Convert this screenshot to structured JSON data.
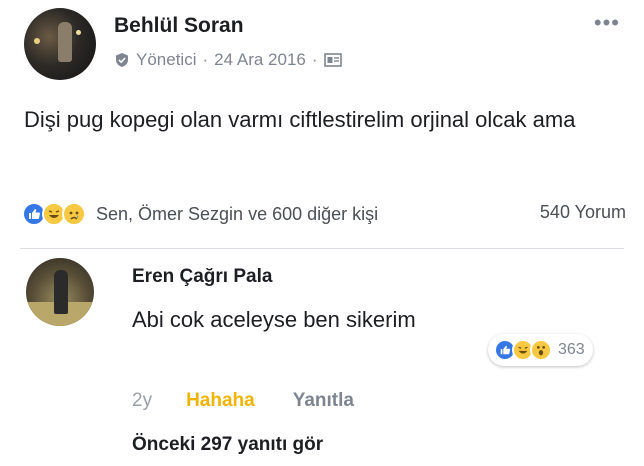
{
  "post": {
    "author": "Behlül Soran",
    "role": "Yönetici",
    "separator": "·",
    "date": "24 Ara 2016",
    "more_label": "•••",
    "text": "Dişi pug kopegi olan varmı ciftlestirelim orjinal olcak ama",
    "reactors": "Sen, Ömer Sezgin ve 600 diğer kişi",
    "comment_count": "540 Yorum"
  },
  "comment": {
    "author": "Eren Çağrı Pala",
    "text": "Abi cok aceleyse ben sikerim",
    "reaction_count": "363",
    "time": "2y",
    "reaction_label": "Hahaha",
    "reply_label": "Yanıtla"
  },
  "replies": {
    "prev_label": "Önceki 297 yanıtı gör"
  },
  "colors": {
    "like": "#3578e5",
    "haha": "#f7c841",
    "haha_text": "#f0b400"
  },
  "icons": [
    "admin-shield-icon",
    "audience-icon",
    "like-icon",
    "haha-icon",
    "sad-icon",
    "wow-icon",
    "more-icon"
  ]
}
